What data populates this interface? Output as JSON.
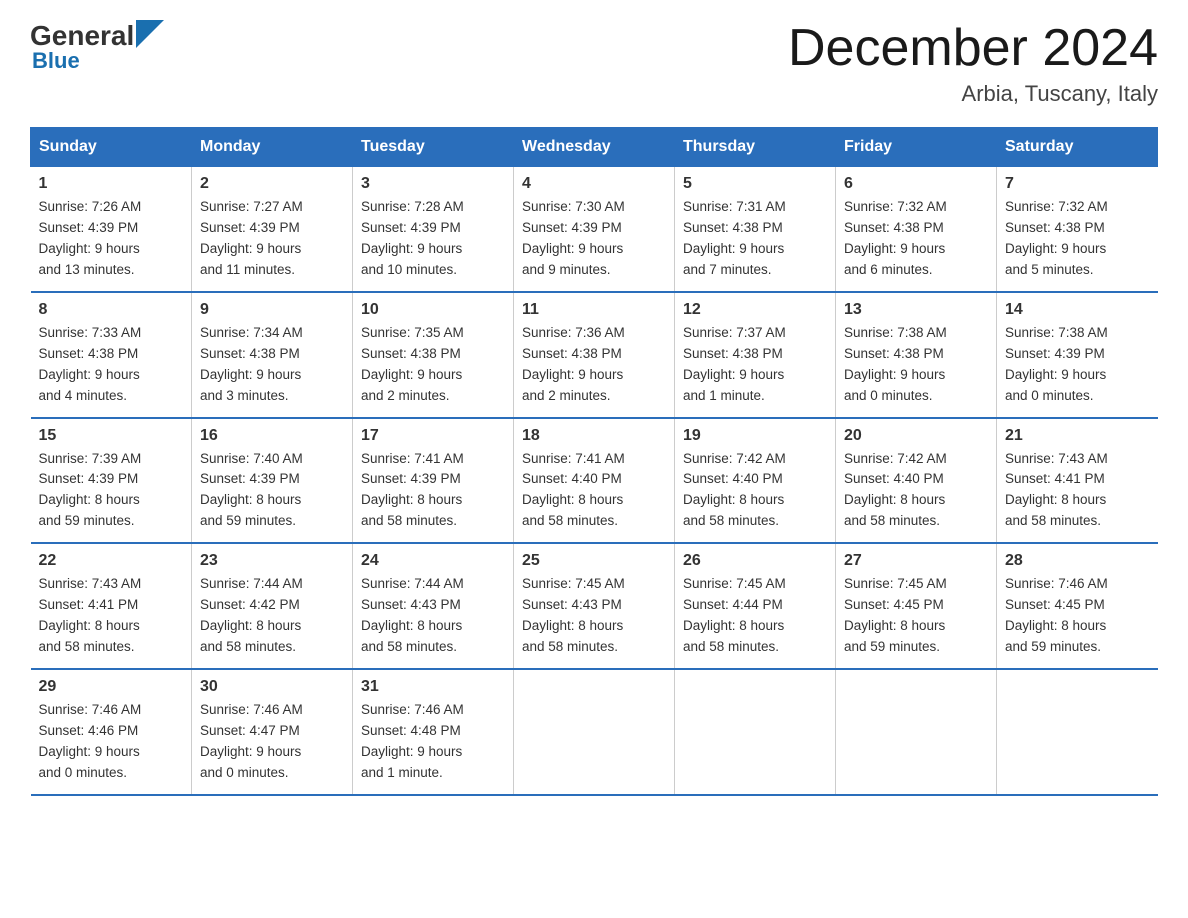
{
  "header": {
    "logo_general": "General",
    "logo_blue": "Blue",
    "month_title": "December 2024",
    "location": "Arbia, Tuscany, Italy"
  },
  "days_of_week": [
    "Sunday",
    "Monday",
    "Tuesday",
    "Wednesday",
    "Thursday",
    "Friday",
    "Saturday"
  ],
  "weeks": [
    [
      {
        "num": "1",
        "sunrise": "7:26 AM",
        "sunset": "4:39 PM",
        "daylight": "9 hours and 13 minutes."
      },
      {
        "num": "2",
        "sunrise": "7:27 AM",
        "sunset": "4:39 PM",
        "daylight": "9 hours and 11 minutes."
      },
      {
        "num": "3",
        "sunrise": "7:28 AM",
        "sunset": "4:39 PM",
        "daylight": "9 hours and 10 minutes."
      },
      {
        "num": "4",
        "sunrise": "7:30 AM",
        "sunset": "4:39 PM",
        "daylight": "9 hours and 9 minutes."
      },
      {
        "num": "5",
        "sunrise": "7:31 AM",
        "sunset": "4:38 PM",
        "daylight": "9 hours and 7 minutes."
      },
      {
        "num": "6",
        "sunrise": "7:32 AM",
        "sunset": "4:38 PM",
        "daylight": "9 hours and 6 minutes."
      },
      {
        "num": "7",
        "sunrise": "7:32 AM",
        "sunset": "4:38 PM",
        "daylight": "9 hours and 5 minutes."
      }
    ],
    [
      {
        "num": "8",
        "sunrise": "7:33 AM",
        "sunset": "4:38 PM",
        "daylight": "9 hours and 4 minutes."
      },
      {
        "num": "9",
        "sunrise": "7:34 AM",
        "sunset": "4:38 PM",
        "daylight": "9 hours and 3 minutes."
      },
      {
        "num": "10",
        "sunrise": "7:35 AM",
        "sunset": "4:38 PM",
        "daylight": "9 hours and 2 minutes."
      },
      {
        "num": "11",
        "sunrise": "7:36 AM",
        "sunset": "4:38 PM",
        "daylight": "9 hours and 2 minutes."
      },
      {
        "num": "12",
        "sunrise": "7:37 AM",
        "sunset": "4:38 PM",
        "daylight": "9 hours and 1 minute."
      },
      {
        "num": "13",
        "sunrise": "7:38 AM",
        "sunset": "4:38 PM",
        "daylight": "9 hours and 0 minutes."
      },
      {
        "num": "14",
        "sunrise": "7:38 AM",
        "sunset": "4:39 PM",
        "daylight": "9 hours and 0 minutes."
      }
    ],
    [
      {
        "num": "15",
        "sunrise": "7:39 AM",
        "sunset": "4:39 PM",
        "daylight": "8 hours and 59 minutes."
      },
      {
        "num": "16",
        "sunrise": "7:40 AM",
        "sunset": "4:39 PM",
        "daylight": "8 hours and 59 minutes."
      },
      {
        "num": "17",
        "sunrise": "7:41 AM",
        "sunset": "4:39 PM",
        "daylight": "8 hours and 58 minutes."
      },
      {
        "num": "18",
        "sunrise": "7:41 AM",
        "sunset": "4:40 PM",
        "daylight": "8 hours and 58 minutes."
      },
      {
        "num": "19",
        "sunrise": "7:42 AM",
        "sunset": "4:40 PM",
        "daylight": "8 hours and 58 minutes."
      },
      {
        "num": "20",
        "sunrise": "7:42 AM",
        "sunset": "4:40 PM",
        "daylight": "8 hours and 58 minutes."
      },
      {
        "num": "21",
        "sunrise": "7:43 AM",
        "sunset": "4:41 PM",
        "daylight": "8 hours and 58 minutes."
      }
    ],
    [
      {
        "num": "22",
        "sunrise": "7:43 AM",
        "sunset": "4:41 PM",
        "daylight": "8 hours and 58 minutes."
      },
      {
        "num": "23",
        "sunrise": "7:44 AM",
        "sunset": "4:42 PM",
        "daylight": "8 hours and 58 minutes."
      },
      {
        "num": "24",
        "sunrise": "7:44 AM",
        "sunset": "4:43 PM",
        "daylight": "8 hours and 58 minutes."
      },
      {
        "num": "25",
        "sunrise": "7:45 AM",
        "sunset": "4:43 PM",
        "daylight": "8 hours and 58 minutes."
      },
      {
        "num": "26",
        "sunrise": "7:45 AM",
        "sunset": "4:44 PM",
        "daylight": "8 hours and 58 minutes."
      },
      {
        "num": "27",
        "sunrise": "7:45 AM",
        "sunset": "4:45 PM",
        "daylight": "8 hours and 59 minutes."
      },
      {
        "num": "28",
        "sunrise": "7:46 AM",
        "sunset": "4:45 PM",
        "daylight": "8 hours and 59 minutes."
      }
    ],
    [
      {
        "num": "29",
        "sunrise": "7:46 AM",
        "sunset": "4:46 PM",
        "daylight": "9 hours and 0 minutes."
      },
      {
        "num": "30",
        "sunrise": "7:46 AM",
        "sunset": "4:47 PM",
        "daylight": "9 hours and 0 minutes."
      },
      {
        "num": "31",
        "sunrise": "7:46 AM",
        "sunset": "4:48 PM",
        "daylight": "9 hours and 1 minute."
      },
      {
        "num": "",
        "sunrise": "",
        "sunset": "",
        "daylight": ""
      },
      {
        "num": "",
        "sunrise": "",
        "sunset": "",
        "daylight": ""
      },
      {
        "num": "",
        "sunrise": "",
        "sunset": "",
        "daylight": ""
      },
      {
        "num": "",
        "sunrise": "",
        "sunset": "",
        "daylight": ""
      }
    ]
  ]
}
